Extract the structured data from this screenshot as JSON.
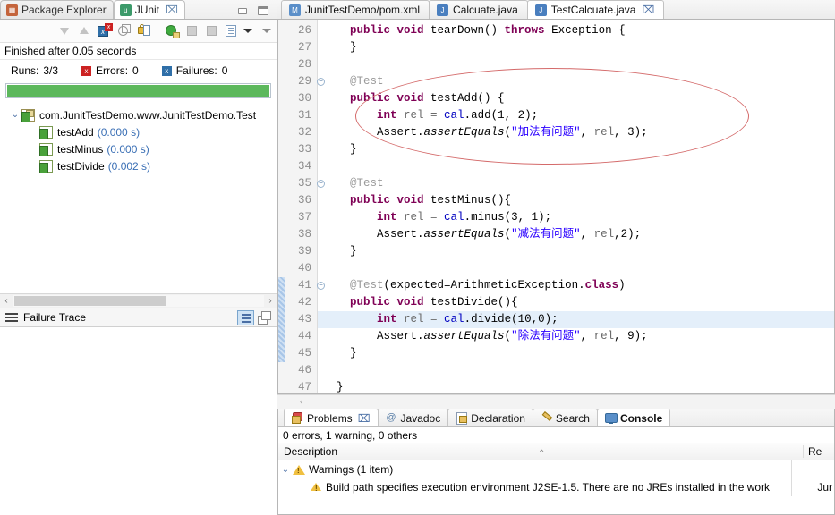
{
  "junit_view": {
    "tabs": [
      {
        "label": "Package Explorer",
        "icon": "package-explorer-icon",
        "active": false,
        "closable": false
      },
      {
        "label": "JUnit",
        "icon": "junit-icon",
        "active": true,
        "closable": true,
        "close_glyph": "⌧"
      }
    ],
    "window_buttons": {
      "minimize": "minimize-button",
      "maximize": "maximize-button"
    },
    "toolbar": [
      "next-failure-icon",
      "previous-failure-icon",
      "show-failures-only-icon",
      "stop-icon",
      "lock-scroll-icon",
      "rerun-test-icon",
      "rerun-failed-icon",
      "stop-test-icon",
      "test-run-history-icon",
      "view-menu-icon",
      "minimize-view-icon"
    ],
    "status_text": "Finished after 0.05 seconds",
    "stats": {
      "runs_label": "Runs:",
      "runs_value": "3/3",
      "errors_label": "Errors:",
      "errors_value": "0",
      "failures_label": "Failures:",
      "failures_value": "0"
    },
    "progress": {
      "percent": 100,
      "color": "#5cb85c"
    },
    "tree": {
      "root": {
        "label": "com.JunitTestDemo.www.JunitTestDemo.Test",
        "expanded": true,
        "twisty": "⌄"
      },
      "items": [
        {
          "name": "testAdd",
          "duration": "(0.000 s)"
        },
        {
          "name": "testMinus",
          "duration": "(0.000 s)"
        },
        {
          "name": "testDivide",
          "duration": "(0.002 s)"
        }
      ]
    },
    "hscroll": {
      "left_arrow": "‹",
      "right_arrow": "›"
    },
    "failure_trace": {
      "label": "Failure Trace",
      "buttons": [
        "filter-stack-trace-button",
        "maximize-trace-button"
      ]
    }
  },
  "editor": {
    "tabs": [
      {
        "label": "JunitTestDemo/pom.xml",
        "icon_letter": "M",
        "icon_kind": "m",
        "active": false,
        "closable": false
      },
      {
        "label": "Calcuate.java",
        "icon_letter": "J",
        "icon_kind": "j",
        "active": false,
        "closable": false
      },
      {
        "label": "TestCalcuate.java",
        "icon_letter": "J",
        "icon_kind": "j",
        "active": true,
        "closable": true,
        "close_glyph": "⌧"
      }
    ],
    "first_line_number": 26,
    "lines": [
      {
        "n": 26,
        "fold": false,
        "changed": false,
        "highlight": false,
        "tokens": [
          {
            "t": "    ",
            "c": ""
          },
          {
            "t": "public void ",
            "c": "k"
          },
          {
            "t": "tearDown() ",
            "c": ""
          },
          {
            "t": "throws ",
            "c": "k"
          },
          {
            "t": "Exception {",
            "c": ""
          }
        ]
      },
      {
        "n": 27,
        "fold": false,
        "changed": false,
        "highlight": false,
        "tokens": [
          {
            "t": "    }",
            "c": ""
          }
        ]
      },
      {
        "n": 28,
        "fold": false,
        "changed": false,
        "highlight": false,
        "tokens": []
      },
      {
        "n": 29,
        "fold": true,
        "changed": false,
        "highlight": false,
        "tokens": [
          {
            "t": "    ",
            "c": ""
          },
          {
            "t": "@Test",
            "c": "ann"
          }
        ]
      },
      {
        "n": 30,
        "fold": false,
        "changed": false,
        "highlight": false,
        "tokens": [
          {
            "t": "    ",
            "c": ""
          },
          {
            "t": "public void ",
            "c": "k"
          },
          {
            "t": "testAdd() {",
            "c": ""
          }
        ]
      },
      {
        "n": 31,
        "fold": false,
        "changed": false,
        "highlight": false,
        "tokens": [
          {
            "t": "        ",
            "c": ""
          },
          {
            "t": "int ",
            "c": "k"
          },
          {
            "t": "rel = ",
            "c": "loc"
          },
          {
            "t": "cal",
            "c": "fld"
          },
          {
            "t": ".add(1, 2);",
            "c": ""
          }
        ]
      },
      {
        "n": 32,
        "fold": false,
        "changed": false,
        "highlight": false,
        "tokens": [
          {
            "t": "        Assert.",
            "c": ""
          },
          {
            "t": "assertEquals",
            "c": "mth"
          },
          {
            "t": "(",
            "c": ""
          },
          {
            "t": "\"加法有问题\"",
            "c": "str"
          },
          {
            "t": ", ",
            "c": ""
          },
          {
            "t": "rel",
            "c": "loc"
          },
          {
            "t": ", 3);",
            "c": ""
          }
        ]
      },
      {
        "n": 33,
        "fold": false,
        "changed": false,
        "highlight": false,
        "tokens": [
          {
            "t": "    }",
            "c": ""
          }
        ]
      },
      {
        "n": 34,
        "fold": false,
        "changed": false,
        "highlight": false,
        "tokens": []
      },
      {
        "n": 35,
        "fold": true,
        "changed": false,
        "highlight": false,
        "tokens": [
          {
            "t": "    ",
            "c": ""
          },
          {
            "t": "@Test",
            "c": "ann"
          }
        ]
      },
      {
        "n": 36,
        "fold": false,
        "changed": false,
        "highlight": false,
        "tokens": [
          {
            "t": "    ",
            "c": ""
          },
          {
            "t": "public void ",
            "c": "k"
          },
          {
            "t": "testMinus(){",
            "c": ""
          }
        ]
      },
      {
        "n": 37,
        "fold": false,
        "changed": false,
        "highlight": false,
        "tokens": [
          {
            "t": "        ",
            "c": ""
          },
          {
            "t": "int ",
            "c": "k"
          },
          {
            "t": "rel = ",
            "c": "loc"
          },
          {
            "t": "cal",
            "c": "fld"
          },
          {
            "t": ".minus(3, 1);",
            "c": ""
          }
        ]
      },
      {
        "n": 38,
        "fold": false,
        "changed": false,
        "highlight": false,
        "tokens": [
          {
            "t": "        Assert.",
            "c": ""
          },
          {
            "t": "assertEquals",
            "c": "mth"
          },
          {
            "t": "(",
            "c": ""
          },
          {
            "t": "\"减法有问题\"",
            "c": "str"
          },
          {
            "t": ", ",
            "c": ""
          },
          {
            "t": "rel",
            "c": "loc"
          },
          {
            "t": ",2);",
            "c": ""
          }
        ]
      },
      {
        "n": 39,
        "fold": false,
        "changed": false,
        "highlight": false,
        "tokens": [
          {
            "t": "    }",
            "c": ""
          }
        ]
      },
      {
        "n": 40,
        "fold": false,
        "changed": false,
        "highlight": false,
        "tokens": []
      },
      {
        "n": 41,
        "fold": true,
        "changed": true,
        "highlight": false,
        "tokens": [
          {
            "t": "    ",
            "c": ""
          },
          {
            "t": "@Test",
            "c": "ann"
          },
          {
            "t": "(expected=ArithmeticException.",
            "c": ""
          },
          {
            "t": "class",
            "c": "k"
          },
          {
            "t": ")",
            "c": ""
          }
        ]
      },
      {
        "n": 42,
        "fold": false,
        "changed": true,
        "highlight": false,
        "tokens": [
          {
            "t": "    ",
            "c": ""
          },
          {
            "t": "public void ",
            "c": "k"
          },
          {
            "t": "testDivide(){",
            "c": ""
          }
        ]
      },
      {
        "n": 43,
        "fold": false,
        "changed": true,
        "highlight": true,
        "tokens": [
          {
            "t": "        ",
            "c": ""
          },
          {
            "t": "int ",
            "c": "k"
          },
          {
            "t": "rel = ",
            "c": "loc"
          },
          {
            "t": "cal",
            "c": "fld"
          },
          {
            "t": ".divide(10,0);",
            "c": ""
          }
        ]
      },
      {
        "n": 44,
        "fold": false,
        "changed": true,
        "highlight": false,
        "tokens": [
          {
            "t": "        Assert.",
            "c": ""
          },
          {
            "t": "assertEquals",
            "c": "mth"
          },
          {
            "t": "(",
            "c": ""
          },
          {
            "t": "\"除法有问题\"",
            "c": "str"
          },
          {
            "t": ", ",
            "c": ""
          },
          {
            "t": "rel",
            "c": "loc"
          },
          {
            "t": ", 9);",
            "c": ""
          }
        ]
      },
      {
        "n": 45,
        "fold": false,
        "changed": true,
        "highlight": false,
        "tokens": [
          {
            "t": "    }",
            "c": ""
          }
        ]
      },
      {
        "n": 46,
        "fold": false,
        "changed": false,
        "highlight": false,
        "tokens": []
      },
      {
        "n": 47,
        "fold": false,
        "changed": false,
        "highlight": false,
        "tokens": [
          {
            "t": "  }",
            "c": ""
          }
        ]
      }
    ],
    "annotation_ellipse": {
      "color": "#d46a6a",
      "covers_lines": "41-45"
    },
    "bottom_arrow": "‹"
  },
  "problems_view": {
    "tabs": [
      {
        "label": "Problems",
        "icon": "problems-icon",
        "kind": "prob",
        "selected": true,
        "closable": true,
        "close_glyph": "⌧"
      },
      {
        "label": "Javadoc",
        "icon": "javadoc-icon",
        "kind": "jdoc",
        "glyph": "@",
        "selected": false,
        "closable": false
      },
      {
        "label": "Declaration",
        "icon": "declaration-icon",
        "kind": "decl",
        "selected": false,
        "closable": false
      },
      {
        "label": "Search",
        "icon": "search-icon",
        "kind": "srch",
        "selected": false,
        "closable": false
      },
      {
        "label": "Console",
        "icon": "console-icon",
        "kind": "cons",
        "selected": false,
        "bold": true,
        "closable": false
      }
    ],
    "summary": "0 errors, 1 warning, 0 others",
    "columns": {
      "description": "Description",
      "resource": "Re"
    },
    "sort_indicator": "⌃",
    "rows": [
      {
        "type": "group",
        "twisty": "⌄",
        "icon": "warning-icon",
        "label": "Warnings (1 item)",
        "resource": ""
      },
      {
        "type": "item",
        "icon": "warning-item-icon",
        "label": "Build path specifies execution environment J2SE-1.5. There are no JREs installed in the work",
        "resource": "Jur"
      }
    ]
  }
}
